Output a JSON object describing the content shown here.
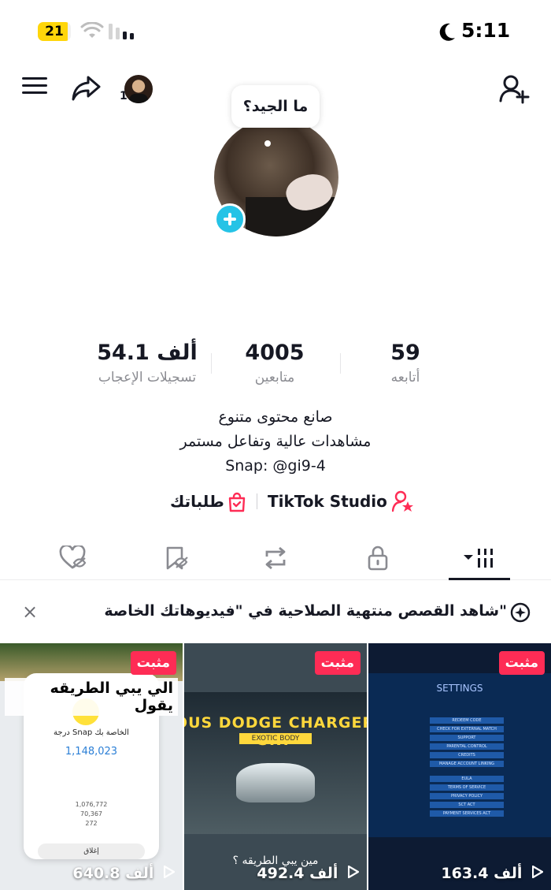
{
  "status_bar": {
    "battery": "21",
    "time": "5:11"
  },
  "top_nav": {
    "avatar_count": "1"
  },
  "profile": {
    "bubble_text": "ما الجيد؟"
  },
  "stats": {
    "likes": {
      "value": "54.1 ألف",
      "label": "تسجيلات الإعجاب"
    },
    "followers": {
      "value": "4005",
      "label": "متابعين"
    },
    "following": {
      "value": "59",
      "label": "أتابعه"
    }
  },
  "bio": {
    "line1": "صانع محتوى متنوع",
    "line2": "مشاهدات عالية وتفاعل مستمر",
    "line3": "Snap: @gi9-4"
  },
  "links": {
    "studio": "TikTok Studio",
    "orders": "طلباتك"
  },
  "tabs": [
    "videos-grid",
    "lock",
    "repost",
    "favorites",
    "liked"
  ],
  "banner": {
    "text": "شاهد القصص منتهية الصلاحية في \"فيديوهاتك الخاصة\"",
    "close": "×"
  },
  "videos": [
    {
      "pinned": "مثبت",
      "views": "640.8 ألف",
      "caption": "الي يبي الطريقه يقول",
      "card_title": "درجة Snap الخاصة بك",
      "card_score": "1,148,023",
      "card_lines": [
        "1,076,772",
        "70,367",
        "272"
      ],
      "card_button": "إغلاق"
    },
    {
      "pinned": "مثبت",
      "views": "492.4 ألف",
      "game_title": "OUS DODGE CHARGER SRT",
      "game_sub": "EXOTIC BODY",
      "caption": "مين يبي الطريقه ؟"
    },
    {
      "pinned": "مثبت",
      "views": "163.4 ألف",
      "screen_title": "SETTINGS",
      "menu": [
        "REDEEM CODE",
        "CHECK FOR EXTERNAL MATCH",
        "SUPPORT",
        "PARENTAL CONTROL",
        "CREDITS",
        "MANAGE ACCOUNT LINKING",
        "EULA",
        "TERMS OF SERVICE",
        "PRIVACY POLICY",
        "SCT ACT",
        "PAYMENT SERVICES ACT"
      ]
    }
  ],
  "colors": {
    "accent": "#fe2c55",
    "text": "#161823",
    "muted": "#8a8b91",
    "story": "#25c3e6"
  }
}
